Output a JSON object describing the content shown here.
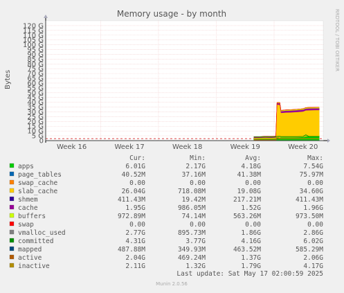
{
  "chart_data": {
    "type": "area",
    "title": "Memory usage - by month",
    "ylabel": "Bytes",
    "ylim": [
      0,
      125
    ],
    "y_unit": "G",
    "yticks": [
      0,
      5,
      10,
      15,
      20,
      25,
      30,
      35,
      40,
      45,
      50,
      55,
      60,
      65,
      70,
      75,
      80,
      85,
      90,
      95,
      100,
      105,
      110,
      115,
      120
    ],
    "ytick_labels": [
      "0",
      "5 G",
      "10 G",
      "15 G",
      "20 G",
      "25 G",
      "30 G",
      "35 G",
      "40 G",
      "45 G",
      "50 G",
      "55 G",
      "60 G",
      "65 G",
      "70 G",
      "75 G",
      "80 G",
      "85 G",
      "90 G",
      "95 G",
      "100 G",
      "105 G",
      "110 G",
      "115 G",
      "120 G"
    ],
    "x_categories": [
      "Week 16",
      "Week 17",
      "Week 18",
      "Week 19",
      "Week 20"
    ],
    "x_range_weeks": [
      15.55,
      20.35
    ],
    "grid": true,
    "side_label": "RRDTOOL / TOBI OETIKER",
    "footer": "Munin 2.0.56",
    "last_update": "Last update: Sat May 17 02:00:59 2025",
    "reference_line": {
      "value": 2.1,
      "color": "#cc0000",
      "style": "dashed"
    },
    "series_times": [
      19.15,
      19.25,
      19.35,
      19.45,
      19.53,
      19.55,
      19.6,
      19.62,
      19.7,
      19.8,
      19.9,
      20.0,
      20.05,
      20.1,
      20.2,
      20.28
    ],
    "stack_order": [
      "apps",
      "page_tables",
      "swap_cache",
      "slab_cache",
      "cache",
      "buffers",
      "swap"
    ],
    "columns": [
      "",
      "Cur:",
      "Min:",
      "Avg:",
      "Max:"
    ],
    "series": [
      {
        "name": "apps",
        "color": "#00cc00",
        "cur": "6.01G",
        "min": "2.17G",
        "avg": "4.18G",
        "max": "7.54G",
        "values": [
          2.2,
          2.3,
          2.4,
          2.3,
          2.5,
          3.0,
          3.2,
          3.4,
          3.5,
          3.5,
          3.6,
          3.8,
          4.5,
          4.7,
          4.8,
          4.9
        ]
      },
      {
        "name": "page_tables",
        "color": "#0066b3",
        "cur": "40.52M",
        "min": "37.16M",
        "avg": "41.38M",
        "max": "75.97M",
        "values": [
          0.04,
          0.04,
          0.04,
          0.04,
          0.04,
          0.04,
          0.04,
          0.04,
          0.04,
          0.04,
          0.04,
          0.04,
          0.04,
          0.04,
          0.04,
          0.04
        ]
      },
      {
        "name": "swap_cache",
        "color": "#ff8000",
        "cur": "0.00",
        "min": "0.00",
        "avg": "0.00",
        "max": "0.00",
        "values": [
          0,
          0,
          0,
          0,
          0,
          0,
          0,
          0,
          0,
          0,
          0,
          0,
          0,
          0,
          0,
          0
        ]
      },
      {
        "name": "slab_cache",
        "color": "#ffcc00",
        "cur": "26.04G",
        "min": "718.08M",
        "avg": "19.08G",
        "max": "34.60G",
        "values": [
          0.7,
          0.7,
          0.8,
          0.8,
          0.8,
          34.6,
          34.2,
          25.5,
          25.8,
          26.0,
          26.3,
          26.6,
          27.0,
          27.0,
          27.0,
          27.0
        ]
      },
      {
        "name": "shmem",
        "color": "#330099",
        "cur": "411.43M",
        "min": "19.42M",
        "avg": "217.21M",
        "max": "411.43M",
        "values": null
      },
      {
        "name": "cache",
        "color": "#990099",
        "cur": "1.95G",
        "min": "986.05M",
        "avg": "1.52G",
        "max": "1.96G",
        "values": [
          1.0,
          1.0,
          1.1,
          1.1,
          1.2,
          1.5,
          1.6,
          1.8,
          1.9,
          1.9,
          1.9,
          1.9,
          1.95,
          1.95,
          1.95,
          1.95
        ]
      },
      {
        "name": "buffers",
        "color": "#ccff00",
        "cur": "972.89M",
        "min": "74.14M",
        "avg": "563.26M",
        "max": "973.50M",
        "values": [
          0.1,
          0.1,
          0.1,
          0.1,
          0.1,
          0.6,
          0.7,
          0.8,
          0.85,
          0.9,
          0.9,
          0.95,
          0.97,
          0.97,
          0.97,
          0.97
        ]
      },
      {
        "name": "swap",
        "color": "#ff0000",
        "cur": "0.00",
        "min": "0.00",
        "avg": "0.00",
        "max": "0.00",
        "values": [
          0,
          0,
          0,
          0,
          0,
          0,
          0,
          0,
          0,
          0,
          0,
          0,
          0,
          0,
          0,
          0
        ]
      },
      {
        "name": "vmalloc_used",
        "color": "#808080",
        "cur": "2.77G",
        "min": "895.73M",
        "avg": "1.86G",
        "max": "2.86G",
        "values": null
      },
      {
        "name": "committed",
        "color": "#008f00",
        "cur": "4.31G",
        "min": "3.77G",
        "avg": "4.16G",
        "max": "6.02G",
        "line_values": [
          3.8,
          3.8,
          3.9,
          3.9,
          3.9,
          4.3,
          4.4,
          4.2,
          4.2,
          4.2,
          4.2,
          4.3,
          6.0,
          4.3,
          4.3,
          4.3
        ]
      },
      {
        "name": "mapped",
        "color": "#00487d",
        "cur": "487.88M",
        "min": "349.93M",
        "avg": "463.52M",
        "max": "585.29M",
        "values": null
      },
      {
        "name": "active",
        "color": "#b35a00",
        "cur": "2.04G",
        "min": "469.24M",
        "avg": "1.37G",
        "max": "2.06G",
        "line_values": [
          0.5,
          0.5,
          0.6,
          0.6,
          0.6,
          1.9,
          1.9,
          2.0,
          2.0,
          2.0,
          2.0,
          2.04,
          2.04,
          2.04,
          2.04,
          2.04
        ]
      },
      {
        "name": "inactive",
        "color": "#b38f00",
        "cur": "2.11G",
        "min": "1.32G",
        "avg": "1.79G",
        "max": "4.17G",
        "line_values": [
          1.4,
          1.4,
          1.5,
          1.5,
          1.5,
          4.1,
          2.0,
          2.0,
          2.05,
          2.1,
          2.1,
          2.11,
          2.11,
          2.11,
          2.11,
          2.11
        ]
      }
    ]
  }
}
